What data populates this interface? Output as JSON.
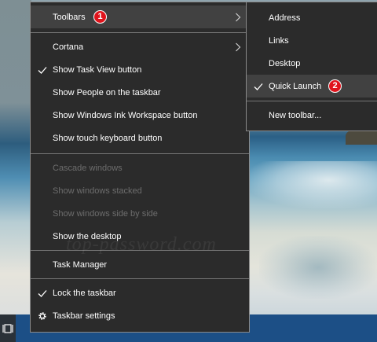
{
  "main_menu": {
    "items": [
      {
        "label": "Toolbars"
      },
      {
        "label": "Cortana"
      },
      {
        "label": "Show Task View button"
      },
      {
        "label": "Show People on the taskbar"
      },
      {
        "label": "Show Windows Ink Workspace button"
      },
      {
        "label": "Show touch keyboard button"
      },
      {
        "label": "Cascade windows"
      },
      {
        "label": "Show windows stacked"
      },
      {
        "label": "Show windows side by side"
      },
      {
        "label": "Show the desktop"
      },
      {
        "label": "Task Manager"
      },
      {
        "label": "Lock the taskbar"
      },
      {
        "label": "Taskbar settings"
      }
    ],
    "checked_items": [
      "Show Task View button",
      "Lock the taskbar"
    ],
    "disabled_items": [
      "Cascade windows",
      "Show windows stacked",
      "Show windows side by side"
    ]
  },
  "toolbars_submenu": {
    "items": [
      {
        "label": "Address"
      },
      {
        "label": "Links"
      },
      {
        "label": "Desktop"
      },
      {
        "label": "Quick Launch"
      },
      {
        "label": "New toolbar..."
      }
    ],
    "checked_items": [
      "Quick Launch"
    ]
  },
  "badges": {
    "step1": "1",
    "step2": "2"
  },
  "watermark": "top-password.com",
  "colors": {
    "menu_bg": "#2b2b2b",
    "menu_highlight": "#414141",
    "menu_border": "#8a8a8a",
    "disabled_text": "#6d6d6d",
    "badge": "#e0141c",
    "taskbar": "#1c4f86"
  },
  "icons": {
    "checkmark": "check-icon",
    "submenu_arrow": "chevron-right-icon",
    "settings": "gear-icon",
    "task_view": "task-view-icon"
  }
}
